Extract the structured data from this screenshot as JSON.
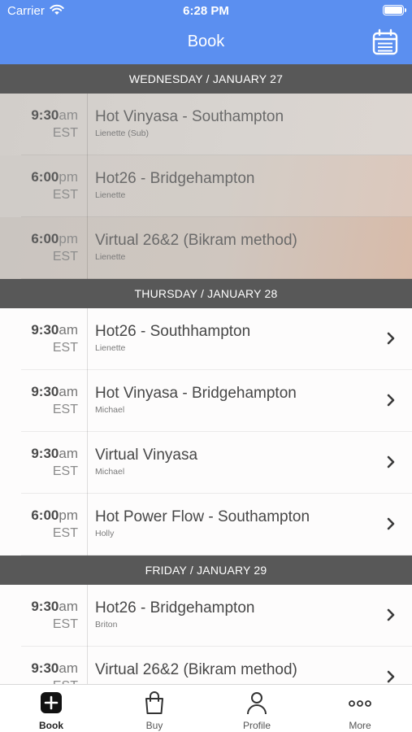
{
  "status_bar": {
    "carrier": "Carrier",
    "time": "6:28 PM"
  },
  "nav": {
    "title": "Book",
    "calendar_icon": "calendar-icon"
  },
  "days": [
    {
      "header": "WEDNESDAY / JANUARY 27",
      "classes": [
        {
          "hm": "9:30",
          "ampm": "am",
          "tz": "EST",
          "title": "Hot Vinyasa - Southampton",
          "instructor": "Lienette (Sub)",
          "past": true
        },
        {
          "hm": "6:00",
          "ampm": "pm",
          "tz": "EST",
          "title": "Hot26 - Bridgehampton",
          "instructor": "Lienette",
          "past": true
        },
        {
          "hm": "6:00",
          "ampm": "pm",
          "tz": "EST",
          "title": "Virtual 26&2 (Bikram method)",
          "instructor": "Lienette",
          "past": true
        }
      ]
    },
    {
      "header": "THURSDAY / JANUARY 28",
      "classes": [
        {
          "hm": "9:30",
          "ampm": "am",
          "tz": "EST",
          "title": "Hot26 - Southhampton",
          "instructor": "Lienette",
          "past": false
        },
        {
          "hm": "9:30",
          "ampm": "am",
          "tz": "EST",
          "title": "Hot Vinyasa - Bridgehampton",
          "instructor": "Michael",
          "past": false
        },
        {
          "hm": "9:30",
          "ampm": "am",
          "tz": "EST",
          "title": "Virtual Vinyasa",
          "instructor": "Michael",
          "past": false
        },
        {
          "hm": "6:00",
          "ampm": "pm",
          "tz": "EST",
          "title": "Hot Power Flow - Southampton",
          "instructor": "Holly",
          "past": false
        }
      ]
    },
    {
      "header": "FRIDAY / JANUARY 29",
      "classes": [
        {
          "hm": "9:30",
          "ampm": "am",
          "tz": "EST",
          "title": "Hot26 - Bridgehampton",
          "instructor": "Briton",
          "past": false
        },
        {
          "hm": "9:30",
          "ampm": "am",
          "tz": "EST",
          "title": "Virtual 26&2 (Bikram method)",
          "instructor": "",
          "past": false
        }
      ]
    }
  ],
  "tabs": [
    {
      "label": "Book",
      "icon": "plus-square-icon",
      "active": true
    },
    {
      "label": "Buy",
      "icon": "shopping-bag-icon",
      "active": false
    },
    {
      "label": "Profile",
      "icon": "person-icon",
      "active": false
    },
    {
      "label": "More",
      "icon": "more-dots-icon",
      "active": false
    }
  ],
  "colors": {
    "nav_blue": "#5b8ff0",
    "day_header": "#585858"
  }
}
